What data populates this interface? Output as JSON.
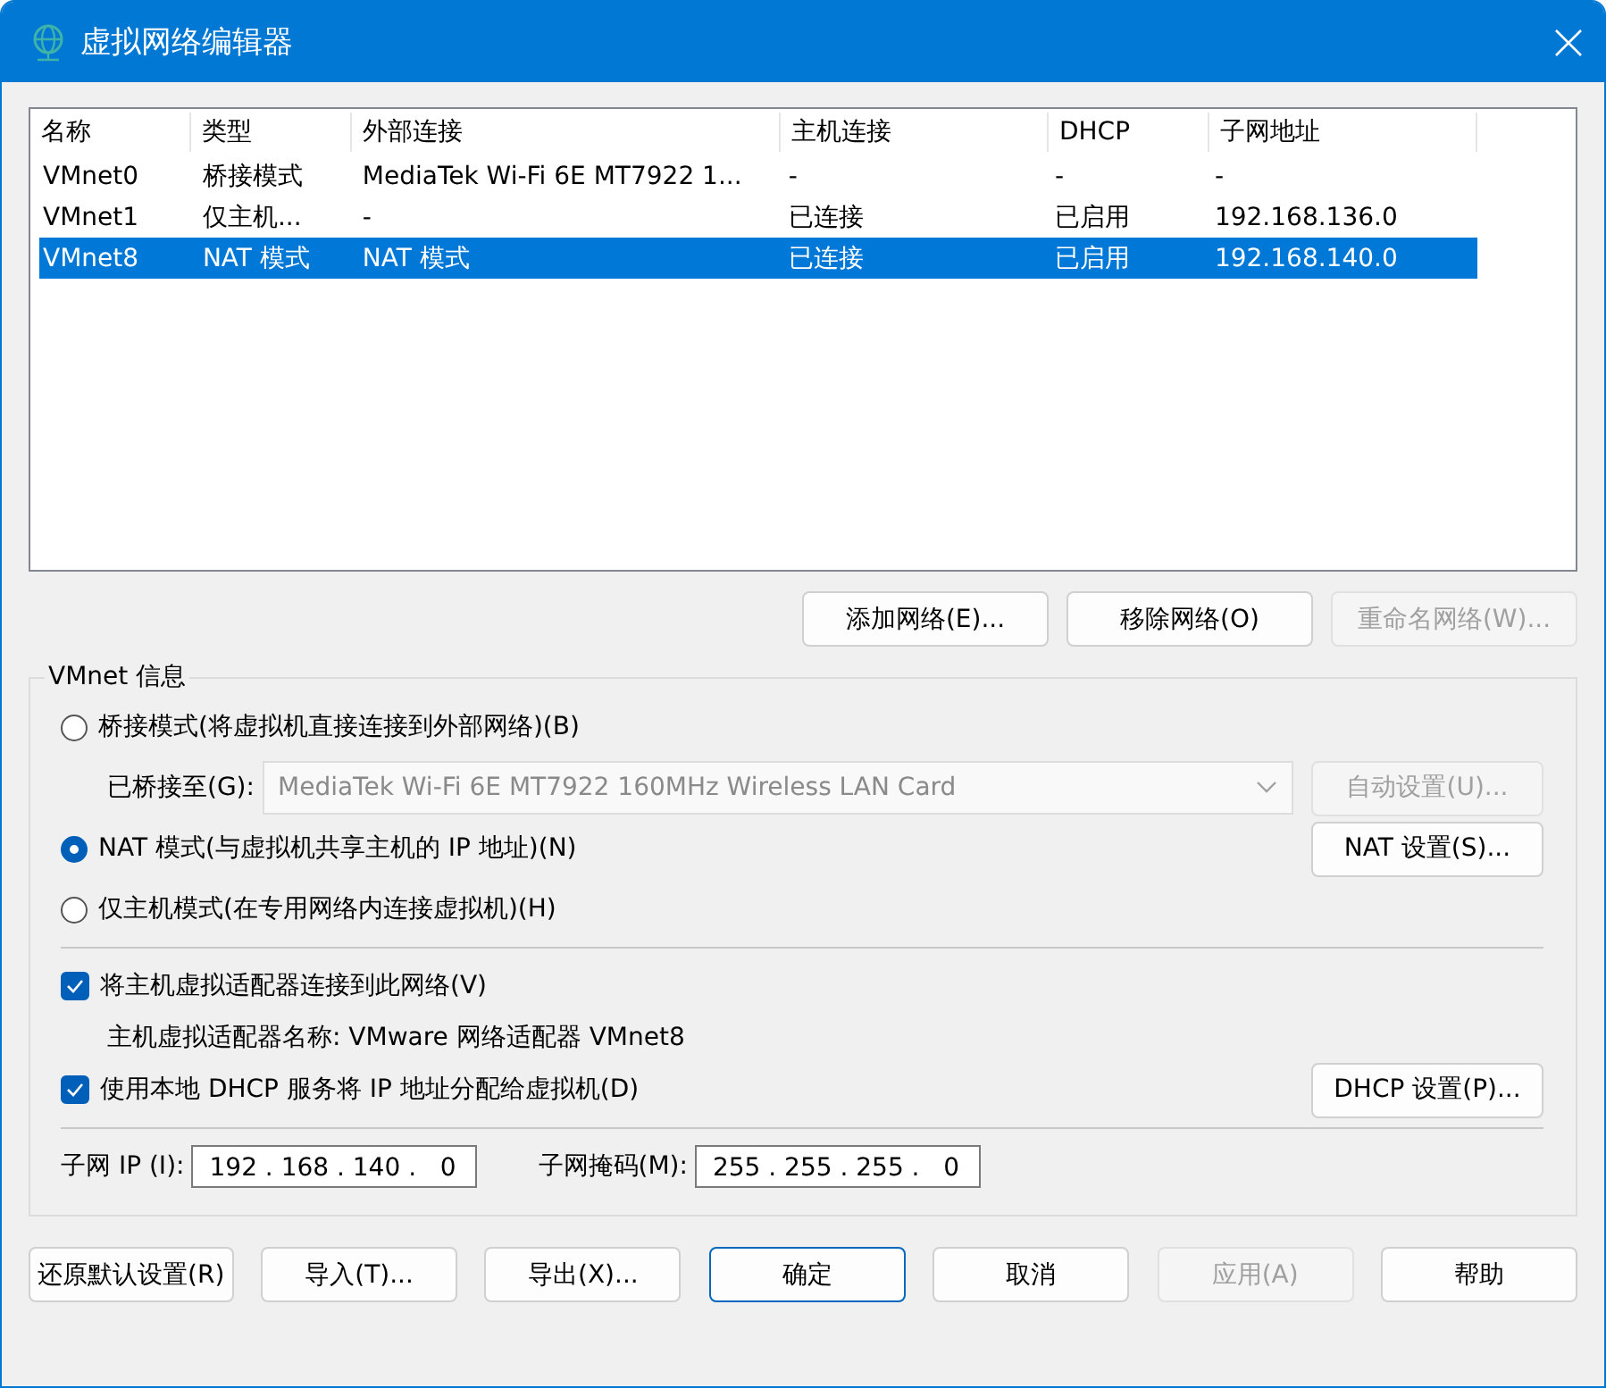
{
  "window": {
    "title": "虚拟网络编辑器"
  },
  "table": {
    "columns": [
      "名称",
      "类型",
      "外部连接",
      "主机连接",
      "DHCP",
      "子网地址"
    ],
    "rows": [
      {
        "cells": [
          "VMnet0",
          "桥接模式",
          "MediaTek Wi-Fi 6E MT7922 1...",
          "-",
          "-",
          "-"
        ],
        "selected": false
      },
      {
        "cells": [
          "VMnet1",
          "仅主机...",
          "-",
          "已连接",
          "已启用",
          "192.168.136.0"
        ],
        "selected": false
      },
      {
        "cells": [
          "VMnet8",
          "NAT 模式",
          "NAT 模式",
          "已连接",
          "已启用",
          "192.168.140.0"
        ],
        "selected": true
      }
    ]
  },
  "list_buttons": [
    {
      "label": "添加网络(E)...",
      "disabled": false
    },
    {
      "label": "移除网络(O)",
      "disabled": false
    },
    {
      "label": "重命名网络(W)...",
      "disabled": true
    }
  ],
  "vmnet_info": {
    "title": "VMnet 信息",
    "modes": [
      {
        "label": "桥接模式(将虚拟机直接连接到外部网络)(B)",
        "selected": false
      },
      {
        "label": "NAT 模式(与虚拟机共享主机的 IP 地址)(N)",
        "selected": true
      },
      {
        "label": "仅主机模式(在专用网络内连接虚拟机)(H)",
        "selected": false
      }
    ],
    "bridged_to": {
      "label": "已桥接至(G):",
      "value": "MediaTek Wi-Fi 6E MT7922 160MHz Wireless LAN Card",
      "disabled": true
    },
    "auto_button": {
      "label": "自动设置(U)...",
      "disabled": true
    },
    "nat_button": {
      "label": "NAT 设置(S)...",
      "disabled": false
    },
    "options": [
      {
        "label": "将主机虚拟适配器连接到此网络(V)",
        "checked": true
      },
      {
        "label": "使用本地 DHCP 服务将 IP 地址分配给虚拟机(D)",
        "checked": true
      }
    ],
    "adapter_name": "主机虚拟适配器名称: VMware 网络适配器 VMnet8",
    "dhcp_button": {
      "label": "DHCP 设置(P)...",
      "disabled": false
    },
    "subnet_ip": {
      "label": "子网 IP (I):",
      "value": "192 . 168 . 140 .   0"
    },
    "subnet_mask": {
      "label": "子网掩码(M):",
      "value": "255 . 255 . 255 .   0"
    }
  },
  "footer_buttons": [
    {
      "label": "还原默认设置(R)",
      "disabled": false,
      "default": false
    },
    {
      "label": "导入(T)...",
      "disabled": false,
      "default": false
    },
    {
      "label": "导出(X)...",
      "disabled": false,
      "default": false
    },
    {
      "label": "确定",
      "disabled": false,
      "default": true
    },
    {
      "label": "取消",
      "disabled": false,
      "default": false
    },
    {
      "label": "应用(A)",
      "disabled": true,
      "default": false
    },
    {
      "label": "帮助",
      "disabled": false,
      "default": false
    }
  ]
}
